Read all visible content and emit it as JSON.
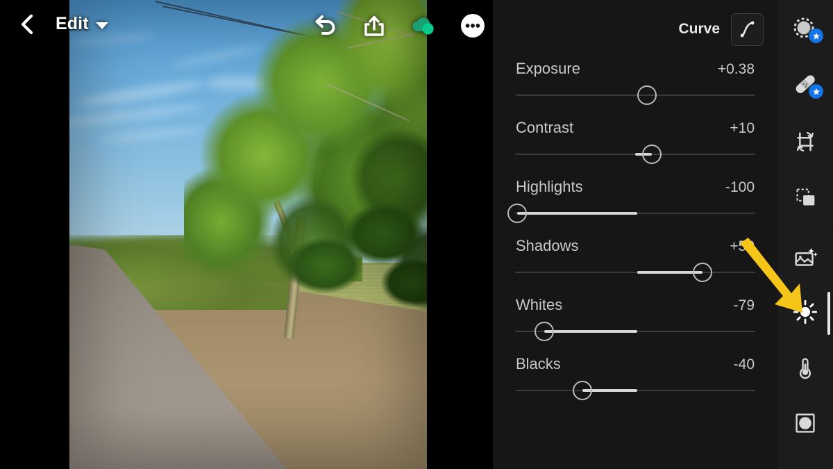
{
  "app": {
    "accent_blue": "#1473e6",
    "annotation_yellow": "#f5c518",
    "panel_bg": "#161616",
    "rail_bg": "#1c1c1c"
  },
  "topbar": {
    "back_icon": "chevron-left-icon",
    "title": "Edit",
    "dropdown_icon": "caret-down-icon",
    "actions": [
      {
        "name": "undo-icon",
        "label": "Undo"
      },
      {
        "name": "share-icon",
        "label": "Share"
      },
      {
        "name": "cloud-sync-icon",
        "label": "Synced",
        "color": "#12b886"
      },
      {
        "name": "more-options-icon",
        "label": "More"
      }
    ]
  },
  "panel": {
    "header": {
      "title": "Curve",
      "button_icon": "tone-curve-icon"
    },
    "sliders": [
      {
        "name": "Exposure",
        "value": "+0.38",
        "pos": 55,
        "fill_from": 55,
        "fill_to": 55
      },
      {
        "name": "Contrast",
        "value": "+10",
        "pos": 57,
        "fill_from": 50,
        "fill_to": 57
      },
      {
        "name": "Highlights",
        "value": "-100",
        "pos": 1,
        "fill_from": 1,
        "fill_to": 51
      },
      {
        "name": "Shadows",
        "value": "+50",
        "pos": 78,
        "fill_from": 51,
        "fill_to": 78
      },
      {
        "name": "Whites",
        "value": "-79",
        "pos": 12,
        "fill_from": 12,
        "fill_to": 51
      },
      {
        "name": "Blacks",
        "value": "-40",
        "pos": 28,
        "fill_from": 28,
        "fill_to": 51
      }
    ]
  },
  "rail": {
    "items": [
      {
        "name": "selective-masking-icon",
        "label": "Masking",
        "badge": true,
        "active": false
      },
      {
        "name": "healing-brush-icon",
        "label": "Healing",
        "badge": true,
        "active": false
      },
      {
        "name": "crop-rotate-icon",
        "label": "Crop",
        "badge": false,
        "active": false
      },
      {
        "name": "versions-icon",
        "label": "Versions",
        "badge": false,
        "active": false
      },
      {
        "name": "auto-enhance-icon",
        "label": "Auto",
        "badge": false,
        "active": false
      },
      {
        "name": "light-icon",
        "label": "Light",
        "badge": false,
        "active": true
      },
      {
        "name": "color-temperature-icon",
        "label": "Color",
        "badge": false,
        "active": false
      },
      {
        "name": "effects-icon",
        "label": "Effects",
        "badge": false,
        "active": false
      }
    ]
  },
  "annotation": {
    "arrow_icon": "pointer-arrow-icon",
    "points_to": "light-icon"
  }
}
